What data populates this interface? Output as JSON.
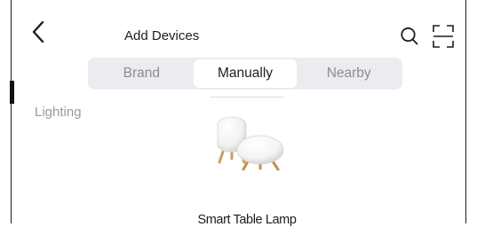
{
  "header": {
    "title": "Add Devices",
    "back_icon": "chevron-left-icon",
    "search_icon": "search-icon",
    "scan_icon": "scan-frame-icon"
  },
  "tabs": [
    {
      "label": "Brand",
      "active": false
    },
    {
      "label": "Manually",
      "active": true
    },
    {
      "label": "Nearby",
      "active": false
    }
  ],
  "section": {
    "title": "Lighting"
  },
  "devices": [
    {
      "name": "Smart Table Lamp",
      "icon": "table-lamp-icon"
    }
  ],
  "colors": {
    "tab_track": "#ececf0",
    "tab_active": "#ffffff",
    "muted_text": "#8c8c90",
    "text": "#1f1f1f"
  }
}
